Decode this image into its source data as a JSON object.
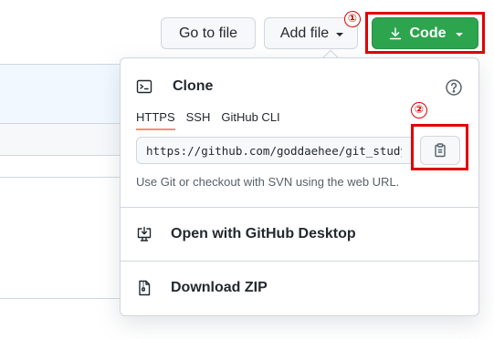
{
  "toolbar": {
    "goto_label": "Go to file",
    "add_label": "Add file",
    "code_label": "Code"
  },
  "annotations": {
    "one": "①",
    "two": "②"
  },
  "clone": {
    "title": "Clone",
    "tabs": [
      "HTTPS",
      "SSH",
      "GitHub CLI"
    ],
    "url": "https://github.com/goddaehee/git_study.git",
    "help": "Use Git or checkout with SVN using the web URL."
  },
  "menu": {
    "desktop_label": "Open with GitHub Desktop",
    "zip_label": "Download ZIP"
  },
  "colors": {
    "code_button": "#2da44e",
    "annotation": "#e00000",
    "active_tab": "#fd8c73"
  }
}
